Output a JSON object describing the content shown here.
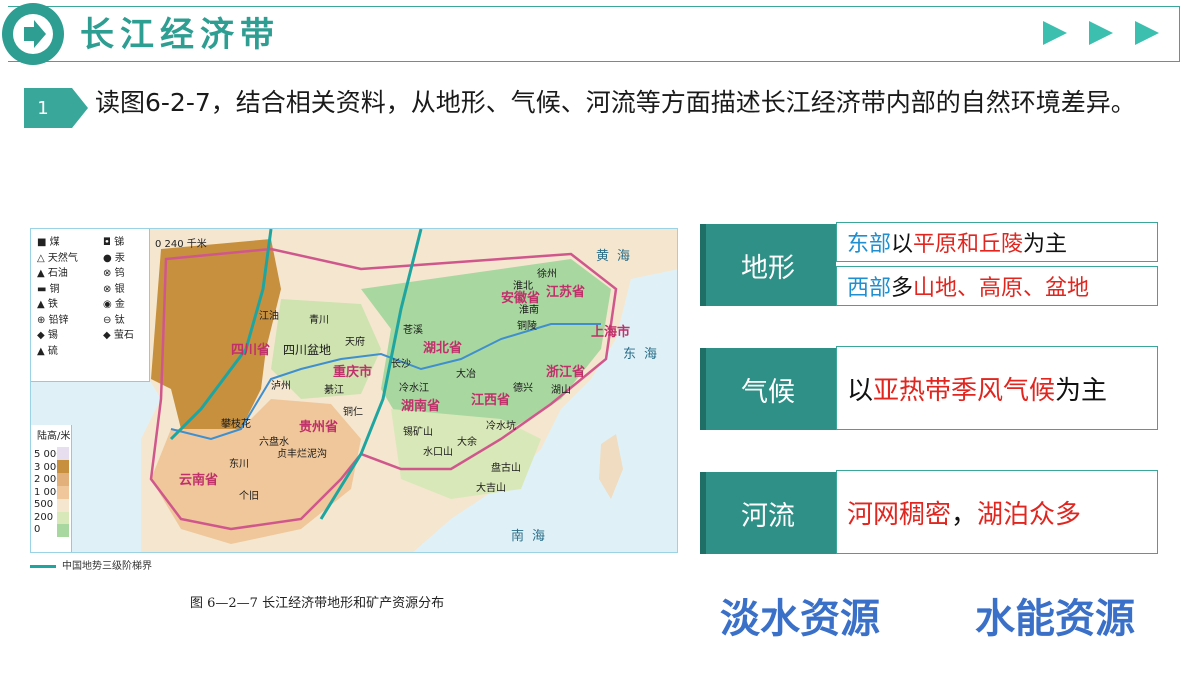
{
  "header": {
    "title": "长江经济带"
  },
  "question": {
    "number": "1",
    "text": "读图6-2-7，结合相关资料，从地形、气候、河流等方面描述长江经济带内部的自然环境差异。"
  },
  "map": {
    "legend_left": [
      "煤",
      "天然气",
      "石油",
      "铜",
      "铁",
      "铅锌",
      "锡",
      "硫"
    ],
    "legend_right": [
      "锑",
      "汞",
      "钨",
      "银",
      "金",
      "钛",
      "萤石"
    ],
    "scale": "0    240 千米",
    "altitude_title": "陆高/米",
    "altitude_values": [
      "5 000",
      "3 000",
      "2 000",
      "1 000",
      "500",
      "200",
      "0"
    ],
    "provinces": [
      "四川省",
      "四川盆地",
      "重庆市",
      "贵州省",
      "云南省",
      "湖北省",
      "湖南省",
      "江西省",
      "安徽省",
      "江苏省",
      "浙江省",
      "上海市"
    ],
    "seas": [
      "黄海",
      "东海",
      "南海"
    ],
    "cities": [
      "徐州",
      "淮北",
      "淮南",
      "铜陵",
      "德兴",
      "湖山",
      "大冶",
      "长沙",
      "冷水江",
      "锡矿山",
      "盘古山",
      "大吉山",
      "綦江",
      "泸州",
      "攀枝花",
      "东川",
      "个旧",
      "六盘水",
      "贞丰烂泥沟",
      "铜仁",
      "江油",
      "天府",
      "苍溪",
      "水口山",
      "大余",
      "冷水坑",
      "青川",
      "铜陵"
    ],
    "colors": {
      "plateau": "#c7903f",
      "hills": "#efc79a",
      "plain": "#a8d7a0",
      "water": "#dff1f7",
      "stair": "#1fa5a0",
      "border": "#d0578c"
    }
  },
  "map_legend_line": "中国地势三级阶梯界",
  "figure_caption": "图 6—2—7    长江经济带地形和矿产资源分布",
  "rows": [
    {
      "label": "地形",
      "lines": [
        {
          "a": "东部",
          "b": "以",
          "c": "平原和丘陵",
          "d": "为主"
        },
        {
          "a": "西部",
          "b": "多",
          "c": "山地、高原、盆地",
          "d": ""
        }
      ]
    },
    {
      "label": "气候",
      "pre": "以",
      "hl": "亚热带季风气候",
      "post": "为主"
    },
    {
      "label": "河流",
      "hl1": "河网稠密",
      "sep": "，",
      "hl2": "湖泊众多"
    }
  ],
  "bottom": {
    "left": "淡水资源",
    "right": "水能资源"
  }
}
